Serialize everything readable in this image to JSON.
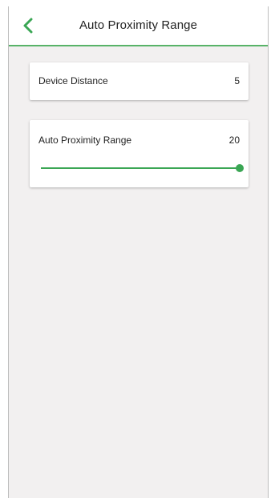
{
  "header": {
    "title": "Auto Proximity Range",
    "back_icon": "chevron-left-icon",
    "accent_color": "#3aa654"
  },
  "device_distance": {
    "label": "Device Distance",
    "value": "5"
  },
  "auto_proximity_range": {
    "label": "Auto Proximity Range",
    "value": "20",
    "slider_fraction": 1.0
  }
}
